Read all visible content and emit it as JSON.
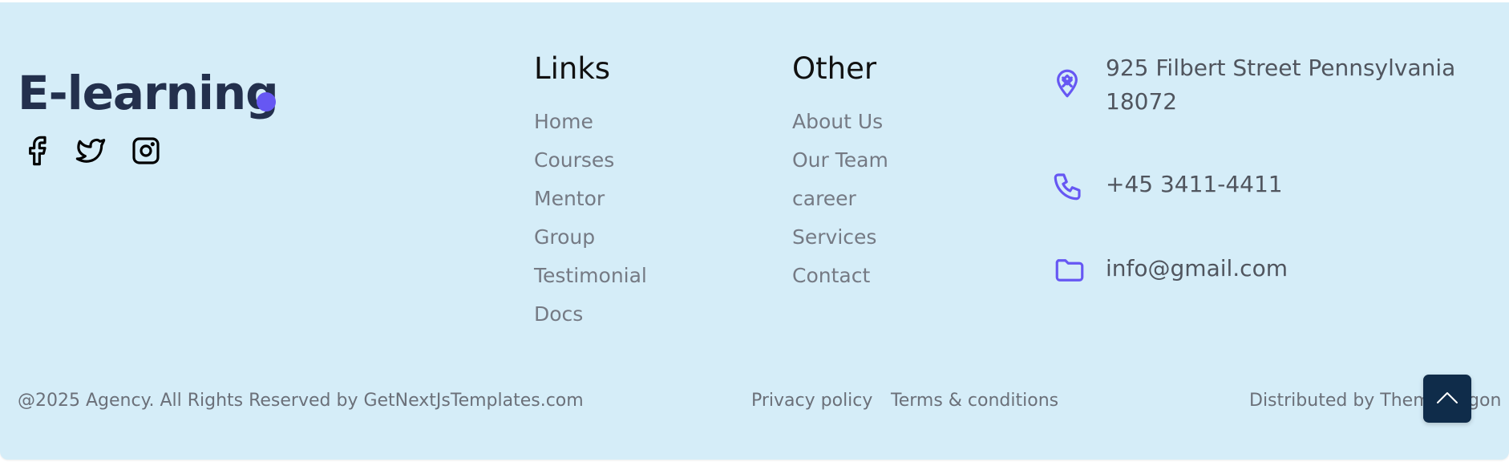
{
  "brand": {
    "name": "E-learning",
    "accent_color": "#6657f3"
  },
  "social": [
    {
      "name": "facebook-icon"
    },
    {
      "name": "twitter-icon"
    },
    {
      "name": "instagram-icon"
    }
  ],
  "links": {
    "title": "Links",
    "items": [
      "Home",
      "Courses",
      "Mentor",
      "Group",
      "Testimonial",
      "Docs"
    ]
  },
  "other": {
    "title": "Other",
    "items": [
      "About Us",
      "Our Team",
      "career",
      "Services",
      "Contact"
    ]
  },
  "contact": {
    "address_line1": "925 Filbert Street Pennsylvania",
    "address_line2": "18072",
    "phone": "+45 3411-4411",
    "email": "info@gmail.com",
    "icon_color": "#6657f3"
  },
  "bottom": {
    "copyright": "@2025 Agency. All Rights Reserved by GetNextJsTemplates.com",
    "privacy": "Privacy policy",
    "terms": "Terms & conditions",
    "distributed": "Distributed by ThemeWagon"
  },
  "scroll_top": {
    "icon": "chevron-up-icon",
    "bg_color": "#0f2c4a"
  }
}
